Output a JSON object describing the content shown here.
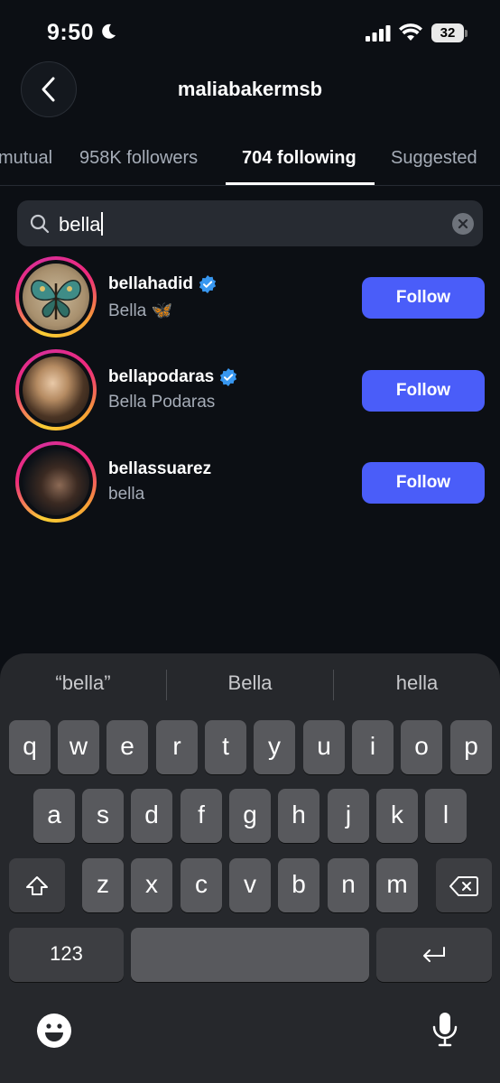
{
  "status": {
    "time": "9:50",
    "battery": "32"
  },
  "header": {
    "title": "maliabakermsb"
  },
  "tabs": [
    {
      "label": "Mutual",
      "visible": "mutual",
      "active": false
    },
    {
      "label": "958K followers",
      "active": false
    },
    {
      "label": "704 following",
      "active": true
    },
    {
      "label": "Suggested",
      "active": false
    }
  ],
  "search": {
    "value": "bella"
  },
  "users": [
    {
      "username": "bellahadid",
      "name": "Bella 🦋",
      "verified": true,
      "button": "Follow"
    },
    {
      "username": "bellapodaras",
      "name": "Bella Podaras",
      "verified": true,
      "button": "Follow"
    },
    {
      "username": "bellassuarez",
      "name": "bella",
      "verified": false,
      "button": "Follow"
    }
  ],
  "keyboard": {
    "suggestions": [
      "“bella”",
      "Bella",
      "hella"
    ],
    "row1": [
      "q",
      "w",
      "e",
      "r",
      "t",
      "y",
      "u",
      "i",
      "o",
      "p"
    ],
    "row2": [
      "a",
      "s",
      "d",
      "f",
      "g",
      "h",
      "j",
      "k",
      "l"
    ],
    "row3": [
      "z",
      "x",
      "c",
      "v",
      "b",
      "n",
      "m"
    ],
    "numbers_key": "123"
  },
  "colors": {
    "accent": "#4a5df9",
    "verified": "#3897f0",
    "background": "#0c0f14"
  }
}
